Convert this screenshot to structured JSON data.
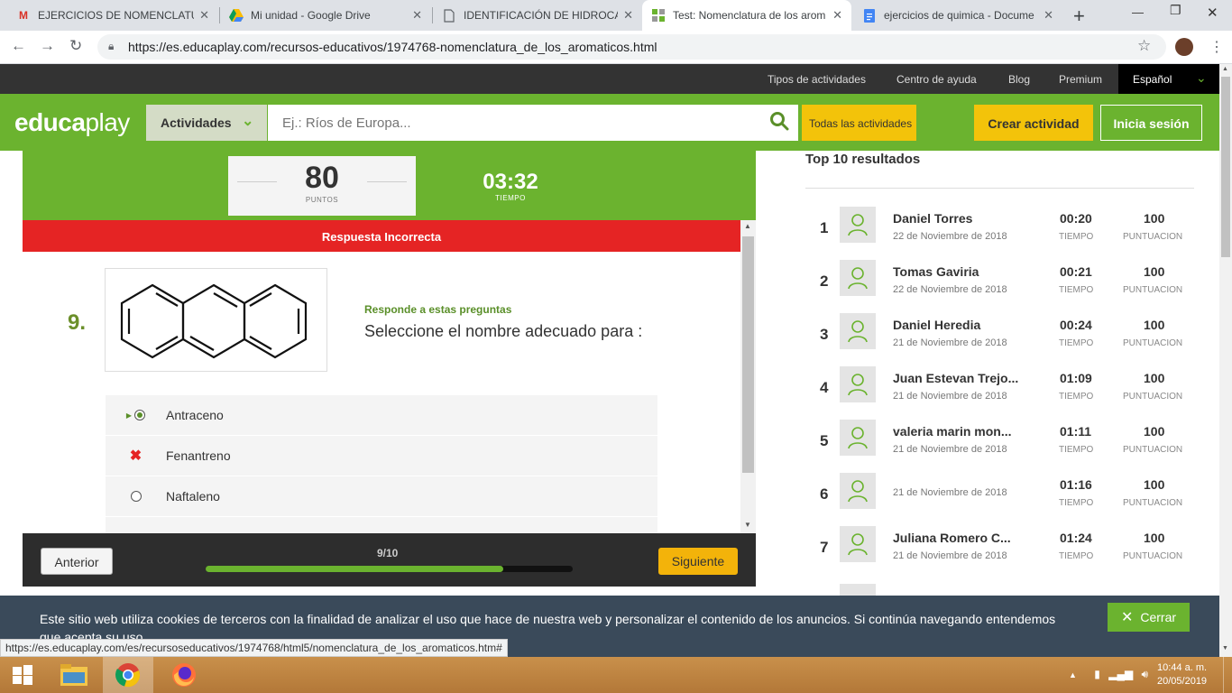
{
  "browser": {
    "tabs": [
      {
        "title": "EJERCICIOS DE NOMENCLATUR",
        "icon": "gmail-icon"
      },
      {
        "title": "Mi unidad - Google Drive",
        "icon": "drive-icon"
      },
      {
        "title": "IDENTIFICACIÓN DE HIDROCAR",
        "icon": "doc-icon"
      },
      {
        "title": "Test: Nomenclatura de los arom",
        "icon": "educaplay-icon"
      },
      {
        "title": "ejercicios de quimica - Docume",
        "icon": "docs-icon"
      }
    ],
    "url": "https://es.educaplay.com/recursos-educativos/1974768-nomenclatura_de_los_aromaticos.html",
    "status_url": "https://es.educaplay.com/es/recursoseducativos/1974768/html5/nomenclatura_de_los_aromaticos.htm#"
  },
  "site": {
    "top_links": [
      "Tipos de actividades",
      "Centro de ayuda",
      "Blog",
      "Premium"
    ],
    "language": "Español",
    "logo_a": "educa",
    "logo_b": "play",
    "activities_label": "Actividades",
    "search_placeholder": "Ej.: Ríos de Europa...",
    "all_activities": "Todas las actividades",
    "create_activity": "Crear actividad",
    "login": "Inicia sesión"
  },
  "game": {
    "score": "80",
    "score_label": "PUNTOS",
    "time": "03:32",
    "time_label": "TIEMPO",
    "feedback": "Respuesta Incorrecta",
    "question_number": "9.",
    "prompt_label": "Responde a estas preguntas",
    "question": "Seleccione el nombre adecuado para :",
    "options": [
      {
        "label": "Antraceno",
        "state": "correct"
      },
      {
        "label": "Fenantreno",
        "state": "wrong"
      },
      {
        "label": "Naftaleno",
        "state": "empty"
      }
    ],
    "prev": "Anterior",
    "next": "Siguiente",
    "progress_text": "9/10",
    "progress": 0.9,
    "accent": "#6bb32f"
  },
  "ranking": {
    "title": "Top 10 resultados",
    "time_label": "TIEMPO",
    "score_label": "PUNTUACION",
    "rows": [
      {
        "pos": "1",
        "name": "Daniel Torres",
        "date": "22 de Noviembre de 2018",
        "time": "00:20",
        "score": "100"
      },
      {
        "pos": "2",
        "name": "Tomas Gaviria",
        "date": "22 de Noviembre de 2018",
        "time": "00:21",
        "score": "100"
      },
      {
        "pos": "3",
        "name": "Daniel Heredia",
        "date": "21 de Noviembre de 2018",
        "time": "00:24",
        "score": "100"
      },
      {
        "pos": "4",
        "name": "Juan Estevan Trejo...",
        "date": "21 de Noviembre de 2018",
        "time": "01:09",
        "score": "100"
      },
      {
        "pos": "5",
        "name": "valeria marin mon...",
        "date": "21 de Noviembre de 2018",
        "time": "01:11",
        "score": "100"
      },
      {
        "pos": "6",
        "name": "",
        "date": "21 de Noviembre de 2018",
        "time": "01:16",
        "score": "100"
      },
      {
        "pos": "7",
        "name": "Juliana Romero C...",
        "date": "21 de Noviembre de 2018",
        "time": "01:24",
        "score": "100"
      }
    ]
  },
  "cookie": {
    "text": "Este sitio web utiliza cookies de terceros con la finalidad de analizar el uso que hace de nuestra web y personalizar el contenido de los anuncios. Si continúa navegando entendemos que acepta su uso.",
    "close": "Cerrar"
  },
  "taskbar": {
    "time": "10:44 a. m.",
    "date": "20/05/2019"
  }
}
